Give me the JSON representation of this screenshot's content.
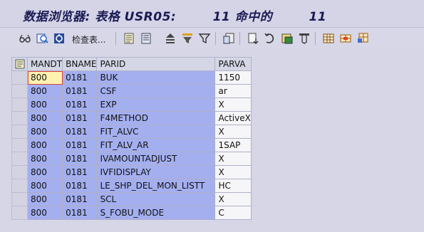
{
  "window": {
    "title": "数据浏览器: 表格 USR05:        11 命中的        11"
  },
  "toolbar": {
    "check_table_label": "检查表...",
    "icons": [
      "glasses-icon",
      "refresh-icon",
      "selection-icon",
      "check-table-icon",
      "detail-icon",
      "detail2-icon",
      "print-icon",
      "filter-icon",
      "filter2-icon",
      "export-icon",
      "sort-icon",
      "sort-desc-icon",
      "save-icon",
      "find-icon",
      "grid-icon",
      "layout-icon",
      "layout2-icon"
    ]
  },
  "grid": {
    "columns": [
      "MANDT",
      "BNAME",
      "PARID",
      "PARVA"
    ],
    "rows": [
      {
        "mandt": "800",
        "bname": "0181",
        "parid": "BUK",
        "parva": "1150"
      },
      {
        "mandt": "800",
        "bname": "0181",
        "parid": "CSF",
        "parva": "ar"
      },
      {
        "mandt": "800",
        "bname": "0181",
        "parid": "EXP",
        "parva": "X"
      },
      {
        "mandt": "800",
        "bname": "0181",
        "parid": "F4METHOD",
        "parva": "ActiveX"
      },
      {
        "mandt": "800",
        "bname": "0181",
        "parid": "FIT_ALVC",
        "parva": "X"
      },
      {
        "mandt": "800",
        "bname": "0181",
        "parid": "FIT_ALV_AR",
        "parva": "1SAP"
      },
      {
        "mandt": "800",
        "bname": "0181",
        "parid": "IVAMOUNTADJUST",
        "parva": "X"
      },
      {
        "mandt": "800",
        "bname": "0181",
        "parid": "IVFIDISPLAY",
        "parva": "X"
      },
      {
        "mandt": "800",
        "bname": "0181",
        "parid": "LE_SHP_DEL_MON_LISTT",
        "parva": "HC"
      },
      {
        "mandt": "800",
        "bname": "0181",
        "parid": "SCL",
        "parva": "X"
      },
      {
        "mandt": "800",
        "bname": "0181",
        "parid": "S_FOBU_MODE",
        "parva": "C"
      }
    ]
  },
  "colors": {
    "key_cell_bg": "#a4aff0",
    "value_cell_bg": "#f6f6f8",
    "focus_cell_bg": "#fff2b0",
    "title_color": "#1a1a55"
  }
}
